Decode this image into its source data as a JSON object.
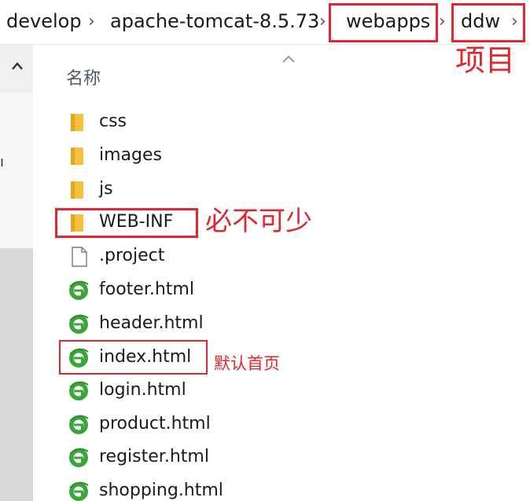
{
  "breadcrumb": {
    "segments": [
      "develop",
      "apache-tomcat-8.5.73",
      "webapps",
      "ddw"
    ]
  },
  "column_header": "名称",
  "files": [
    {
      "name": "css",
      "icon": "folder-icon"
    },
    {
      "name": "images",
      "icon": "folder-icon"
    },
    {
      "name": "js",
      "icon": "folder-icon"
    },
    {
      "name": "WEB-INF",
      "icon": "folder-icon"
    },
    {
      "name": ".project",
      "icon": "file-icon"
    },
    {
      "name": "footer.html",
      "icon": "ie-html-icon"
    },
    {
      "name": "header.html",
      "icon": "ie-html-icon"
    },
    {
      "name": "index.html",
      "icon": "ie-html-icon"
    },
    {
      "name": "login.html",
      "icon": "ie-html-icon"
    },
    {
      "name": "product.html",
      "icon": "ie-html-icon"
    },
    {
      "name": "register.html",
      "icon": "ie-html-icon"
    },
    {
      "name": "shopping.html",
      "icon": "ie-html-icon"
    }
  ],
  "annotations": {
    "project": "项目",
    "required": "必不可少",
    "default_home": "默认首页"
  },
  "colors": {
    "annotation_red": "#e3262d",
    "folder_yellow": "#f5c13d",
    "ie_green": "#3aa63a"
  }
}
